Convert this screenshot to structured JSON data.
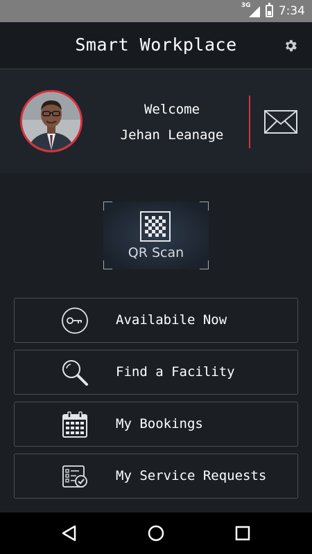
{
  "status_bar": {
    "network": "3G",
    "time": "7:34"
  },
  "app_bar": {
    "title": "Smart Workplace",
    "settings_icon": "gear-icon"
  },
  "profile": {
    "greeting": "Welcome",
    "name": "Jehan Leanage",
    "accent": "#d9303a",
    "mail_icon": "envelope-icon"
  },
  "qr": {
    "label": "QR Scan",
    "icon": "qr-code-icon"
  },
  "menu": {
    "items": [
      {
        "label": "Availabile Now",
        "icon": "key-icon"
      },
      {
        "label": "Find a Facility",
        "icon": "magnifier-icon"
      },
      {
        "label": "My Bookings",
        "icon": "calendar-icon"
      },
      {
        "label": "My Service Requests",
        "icon": "checklist-icon"
      }
    ]
  },
  "nav_bar": {
    "back_icon": "back-triangle-icon",
    "home_icon": "home-circle-icon",
    "recents_icon": "recents-square-icon"
  }
}
